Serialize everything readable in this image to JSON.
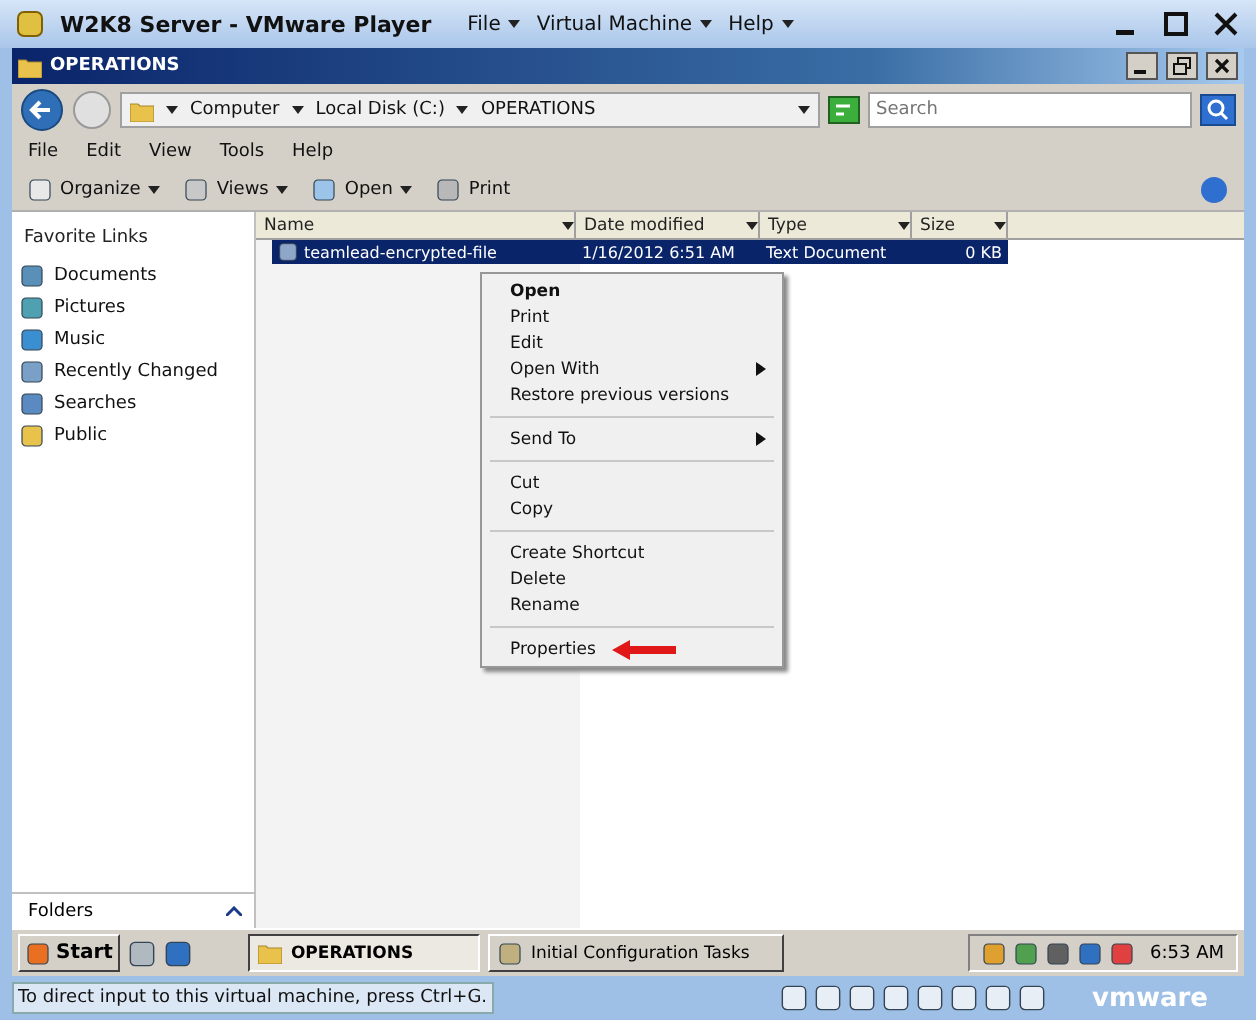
{
  "player": {
    "title": "W2K8 Server - VMware Player",
    "menus": [
      "File",
      "Virtual Machine",
      "Help"
    ]
  },
  "explorer": {
    "title": "OPERATIONS",
    "breadcrumb": [
      "Computer",
      "Local Disk (C:)",
      "OPERATIONS"
    ],
    "search": {
      "placeholder": "Search"
    },
    "menu": [
      "File",
      "Edit",
      "View",
      "Tools",
      "Help"
    ],
    "toolbar": [
      {
        "label": "Organize",
        "dropdown": true
      },
      {
        "label": "Views",
        "dropdown": true
      },
      {
        "label": "Open",
        "dropdown": true
      },
      {
        "label": "Print",
        "dropdown": false
      }
    ],
    "favorites_title": "Favorite Links",
    "favorites": [
      "Documents",
      "Pictures",
      "Music",
      "Recently Changed",
      "Searches",
      "Public"
    ],
    "folders_label": "Folders",
    "columns": [
      "Name",
      "Date modified",
      "Type",
      "Size"
    ],
    "files": [
      {
        "name": "teamlead-encrypted-file",
        "date": "1/16/2012 6:51 AM",
        "type": "Text Document",
        "size": "0 KB",
        "selected": true
      }
    ],
    "context_menu": [
      [
        {
          "label": "Open",
          "default": true,
          "submenu": false
        },
        {
          "label": "Print",
          "default": false,
          "submenu": false
        },
        {
          "label": "Edit",
          "default": false,
          "submenu": false
        },
        {
          "label": "Open With",
          "default": false,
          "submenu": true
        },
        {
          "label": "Restore previous versions",
          "default": false,
          "submenu": false
        }
      ],
      [
        {
          "label": "Send To",
          "default": false,
          "submenu": true
        }
      ],
      [
        {
          "label": "Cut",
          "default": false,
          "submenu": false
        },
        {
          "label": "Copy",
          "default": false,
          "submenu": false
        }
      ],
      [
        {
          "label": "Create Shortcut",
          "default": false,
          "submenu": false
        },
        {
          "label": "Delete",
          "default": false,
          "submenu": false
        },
        {
          "label": "Rename",
          "default": false,
          "submenu": false
        }
      ],
      [
        {
          "label": "Properties",
          "default": false,
          "submenu": false,
          "pointer": true
        }
      ]
    ]
  },
  "taskbar": {
    "start": "Start",
    "tasks": [
      {
        "label": "OPERATIONS",
        "selected": true
      },
      {
        "label": "Initial Configuration Tasks",
        "selected": false
      }
    ],
    "clock": "6:53 AM"
  },
  "status": {
    "hint": "To direct input to this virtual machine, press Ctrl+G.",
    "brand": "vmware"
  }
}
